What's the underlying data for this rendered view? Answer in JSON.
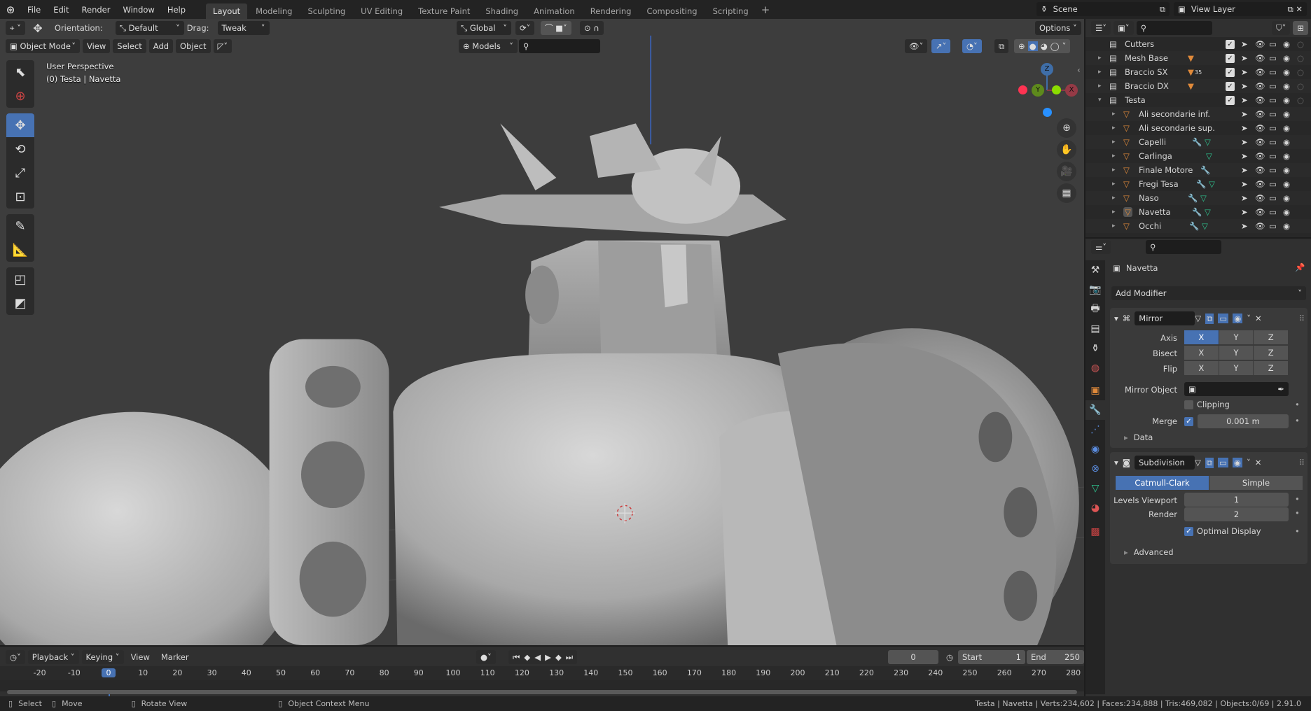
{
  "topbar": {
    "menus": [
      "File",
      "Edit",
      "Render",
      "Window",
      "Help"
    ],
    "workspaces": [
      {
        "label": "Layout",
        "active": true
      },
      {
        "label": "Modeling"
      },
      {
        "label": "Sculpting"
      },
      {
        "label": "UV Editing"
      },
      {
        "label": "Texture Paint"
      },
      {
        "label": "Shading"
      },
      {
        "label": "Animation"
      },
      {
        "label": "Rendering"
      },
      {
        "label": "Compositing"
      },
      {
        "label": "Scripting"
      }
    ],
    "add_workspace": "+",
    "scene": "Scene",
    "view_layer": "View Layer"
  },
  "tool_header": {
    "orientation_label": "Orientation:",
    "orientation_value": "Default",
    "drag_label": "Drag:",
    "drag_value": "Tweak",
    "transform_orientation": "Global",
    "options": "Options"
  },
  "viewport_header": {
    "mode": "Object Mode",
    "menus": [
      "View",
      "Select",
      "Add",
      "Object"
    ],
    "collection_filter": "Models",
    "search_placeholder": ""
  },
  "viewport": {
    "perspective": "User Perspective",
    "context": "(0) Testa | Navetta",
    "gizmo_axes": [
      "Z",
      "Y",
      "X"
    ],
    "colors": {
      "x": "#ff3352",
      "y": "#8bdc00",
      "z": "#2890ff",
      "active": "#4772b3"
    }
  },
  "toolbar": {
    "tools": [
      "select-box",
      "cursor",
      "move",
      "rotate",
      "scale",
      "transform",
      "annotate",
      "measure",
      "add-cube",
      "add-shape"
    ],
    "active": "move"
  },
  "outliner": {
    "rows": [
      {
        "name": "Cutters",
        "type": "collection",
        "depth": 0,
        "expand": ""
      },
      {
        "name": "Mesh Base",
        "type": "collection",
        "depth": 0,
        "expand": "▸",
        "badge": "mesh"
      },
      {
        "name": "Braccio SX",
        "type": "collection",
        "depth": 0,
        "expand": "▸",
        "badge": "mesh",
        "count": "35"
      },
      {
        "name": "Braccio DX",
        "type": "collection",
        "depth": 0,
        "expand": "▸",
        "badge": "mesh"
      },
      {
        "name": "Testa",
        "type": "collection",
        "depth": 0,
        "expand": "▾"
      },
      {
        "name": "Ali secondarie inf.",
        "type": "object",
        "depth": 1,
        "expand": "▸"
      },
      {
        "name": "Ali secondarie sup.",
        "type": "object",
        "depth": 1,
        "expand": "▸"
      },
      {
        "name": "Capelli",
        "type": "object",
        "depth": 1,
        "expand": "▸",
        "modifier": true,
        "data": true
      },
      {
        "name": "Carlinga",
        "type": "object",
        "depth": 1,
        "expand": "▸",
        "data": true
      },
      {
        "name": "Finale Motore",
        "type": "object",
        "depth": 1,
        "expand": "▸",
        "modifier": true
      },
      {
        "name": "Fregi Tesa",
        "type": "object",
        "depth": 1,
        "expand": "▸",
        "modifier": true,
        "data": true
      },
      {
        "name": "Naso",
        "type": "object",
        "depth": 1,
        "expand": "▸",
        "modifier": true,
        "data": true
      },
      {
        "name": "Navetta",
        "type": "object",
        "depth": 1,
        "expand": "▸",
        "modifier": true,
        "data": true,
        "active": true
      },
      {
        "name": "Occhi",
        "type": "object",
        "depth": 1,
        "expand": "▸",
        "modifier": true,
        "data": true
      }
    ]
  },
  "properties": {
    "object_name": "Navetta",
    "add_modifier": "Add Modifier",
    "mirror": {
      "name": "Mirror",
      "axis_label": "Axis",
      "bisect_label": "Bisect",
      "flip_label": "Flip",
      "axes": [
        "X",
        "Y",
        "Z"
      ],
      "axis_active": "X",
      "mirror_object_label": "Mirror Object",
      "clipping_label": "Clipping",
      "clipping": false,
      "merge_label": "Merge",
      "merge": true,
      "merge_value": "0.001 m",
      "data_label": "Data"
    },
    "subdivision": {
      "name": "Subdivision",
      "catmull": "Catmull-Clark",
      "simple": "Simple",
      "levels_viewport_label": "Levels Viewport",
      "levels_viewport": "1",
      "render_label": "Render",
      "render": "2",
      "optimal_label": "Optimal Display",
      "optimal": true,
      "advanced_label": "Advanced"
    }
  },
  "timeline": {
    "menus": [
      "Playback",
      "Keying",
      "View",
      "Marker"
    ],
    "current_frame": "0",
    "start_label": "Start",
    "start": "1",
    "end_label": "End",
    "end": "250",
    "ticks": [
      "-20",
      "-10",
      "0",
      "10",
      "20",
      "30",
      "40",
      "50",
      "60",
      "70",
      "80",
      "90",
      "100",
      "110",
      "120",
      "130",
      "140",
      "150",
      "160",
      "170",
      "180",
      "190",
      "200",
      "210",
      "220",
      "230",
      "240",
      "250",
      "260",
      "270",
      "280"
    ]
  },
  "statusbar": {
    "select": "Select",
    "move": "Move",
    "rotate": "Rotate View",
    "context_menu": "Object Context Menu",
    "stats": "Testa | Navetta | Verts:234,602 | Faces:234,888 | Tris:469,082 | Objects:0/69 | 2.91.0"
  }
}
